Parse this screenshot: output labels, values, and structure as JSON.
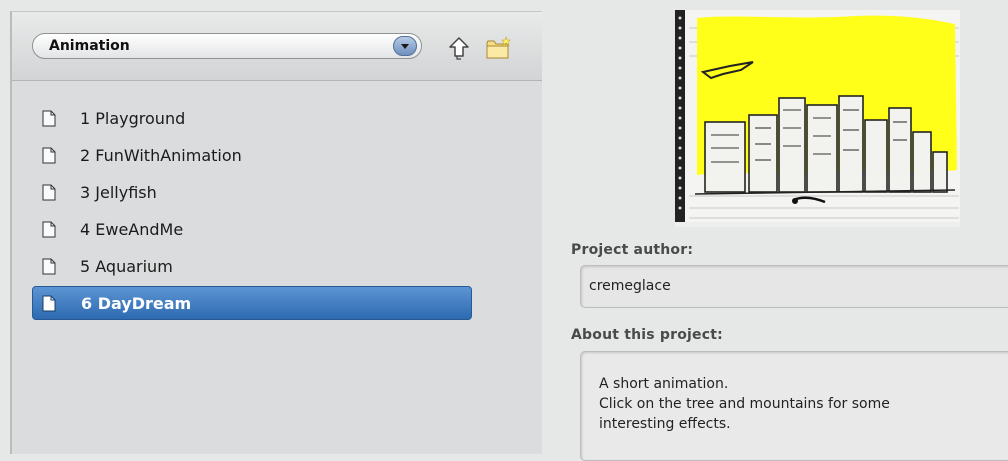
{
  "browser": {
    "folder_select": {
      "selected": "Animation"
    },
    "toolbar": {
      "up_icon": "up-arrow-icon",
      "new_folder_icon": "new-folder-icon"
    },
    "projects": [
      {
        "label": "1 Playground",
        "selected": false
      },
      {
        "label": "2 FunWithAnimation",
        "selected": false
      },
      {
        "label": "3 Jellyfish",
        "selected": false
      },
      {
        "label": "4 EweAndMe",
        "selected": false
      },
      {
        "label": "5 Aquarium",
        "selected": false
      },
      {
        "label": "6 DayDream",
        "selected": true
      }
    ]
  },
  "details": {
    "thumbnail": "project-thumbnail-sketch-city-yellow",
    "author_heading": "Project author:",
    "author": "cremeglace",
    "about_heading": "About this project:",
    "about_lines": [
      "A short animation.",
      "Click on the tree and mountains for some",
      "interesting effects."
    ]
  },
  "colors": {
    "selection": "#3b78c0",
    "thumbnail_yellow": "#ffff1a",
    "panel": "#dadcdd"
  }
}
